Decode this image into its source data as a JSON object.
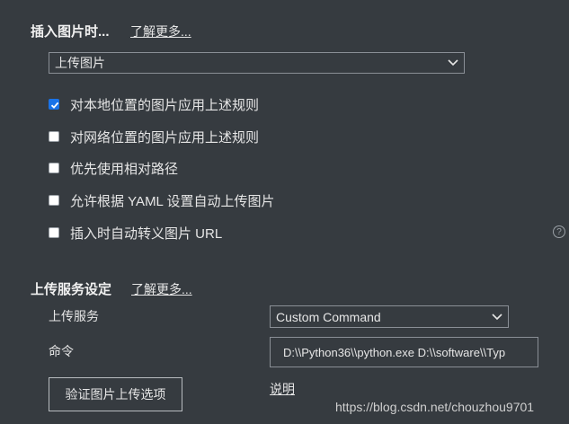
{
  "insert_image": {
    "title": "插入图片时...",
    "learn_more": "了解更多...",
    "select_value": "上传图片",
    "options": [
      {
        "label": "对本地位置的图片应用上述规则",
        "checked": true
      },
      {
        "label": "对网络位置的图片应用上述规则",
        "checked": false
      },
      {
        "label": "优先使用相对路径",
        "checked": false
      },
      {
        "label": "允许根据 YAML 设置自动上传图片",
        "checked": false
      },
      {
        "label": "插入时自动转义图片 URL",
        "checked": false
      }
    ],
    "help_icon": "?"
  },
  "upload_service": {
    "title": "上传服务设定",
    "learn_more": "了解更多...",
    "service_label": "上传服务",
    "service_value": "Custom Command",
    "command_label": "命令",
    "command_value": "D:\\\\Python36\\\\python.exe D:\\\\software\\\\Typ",
    "verify_button": "验证图片上传选项",
    "help_link": "说明"
  },
  "watermark": "https://blog.csdn.net/chouzhou9701",
  "colors": {
    "background": "#363b40",
    "checkbox_checked": "#1a73e8",
    "text": "#e6e6e6"
  }
}
